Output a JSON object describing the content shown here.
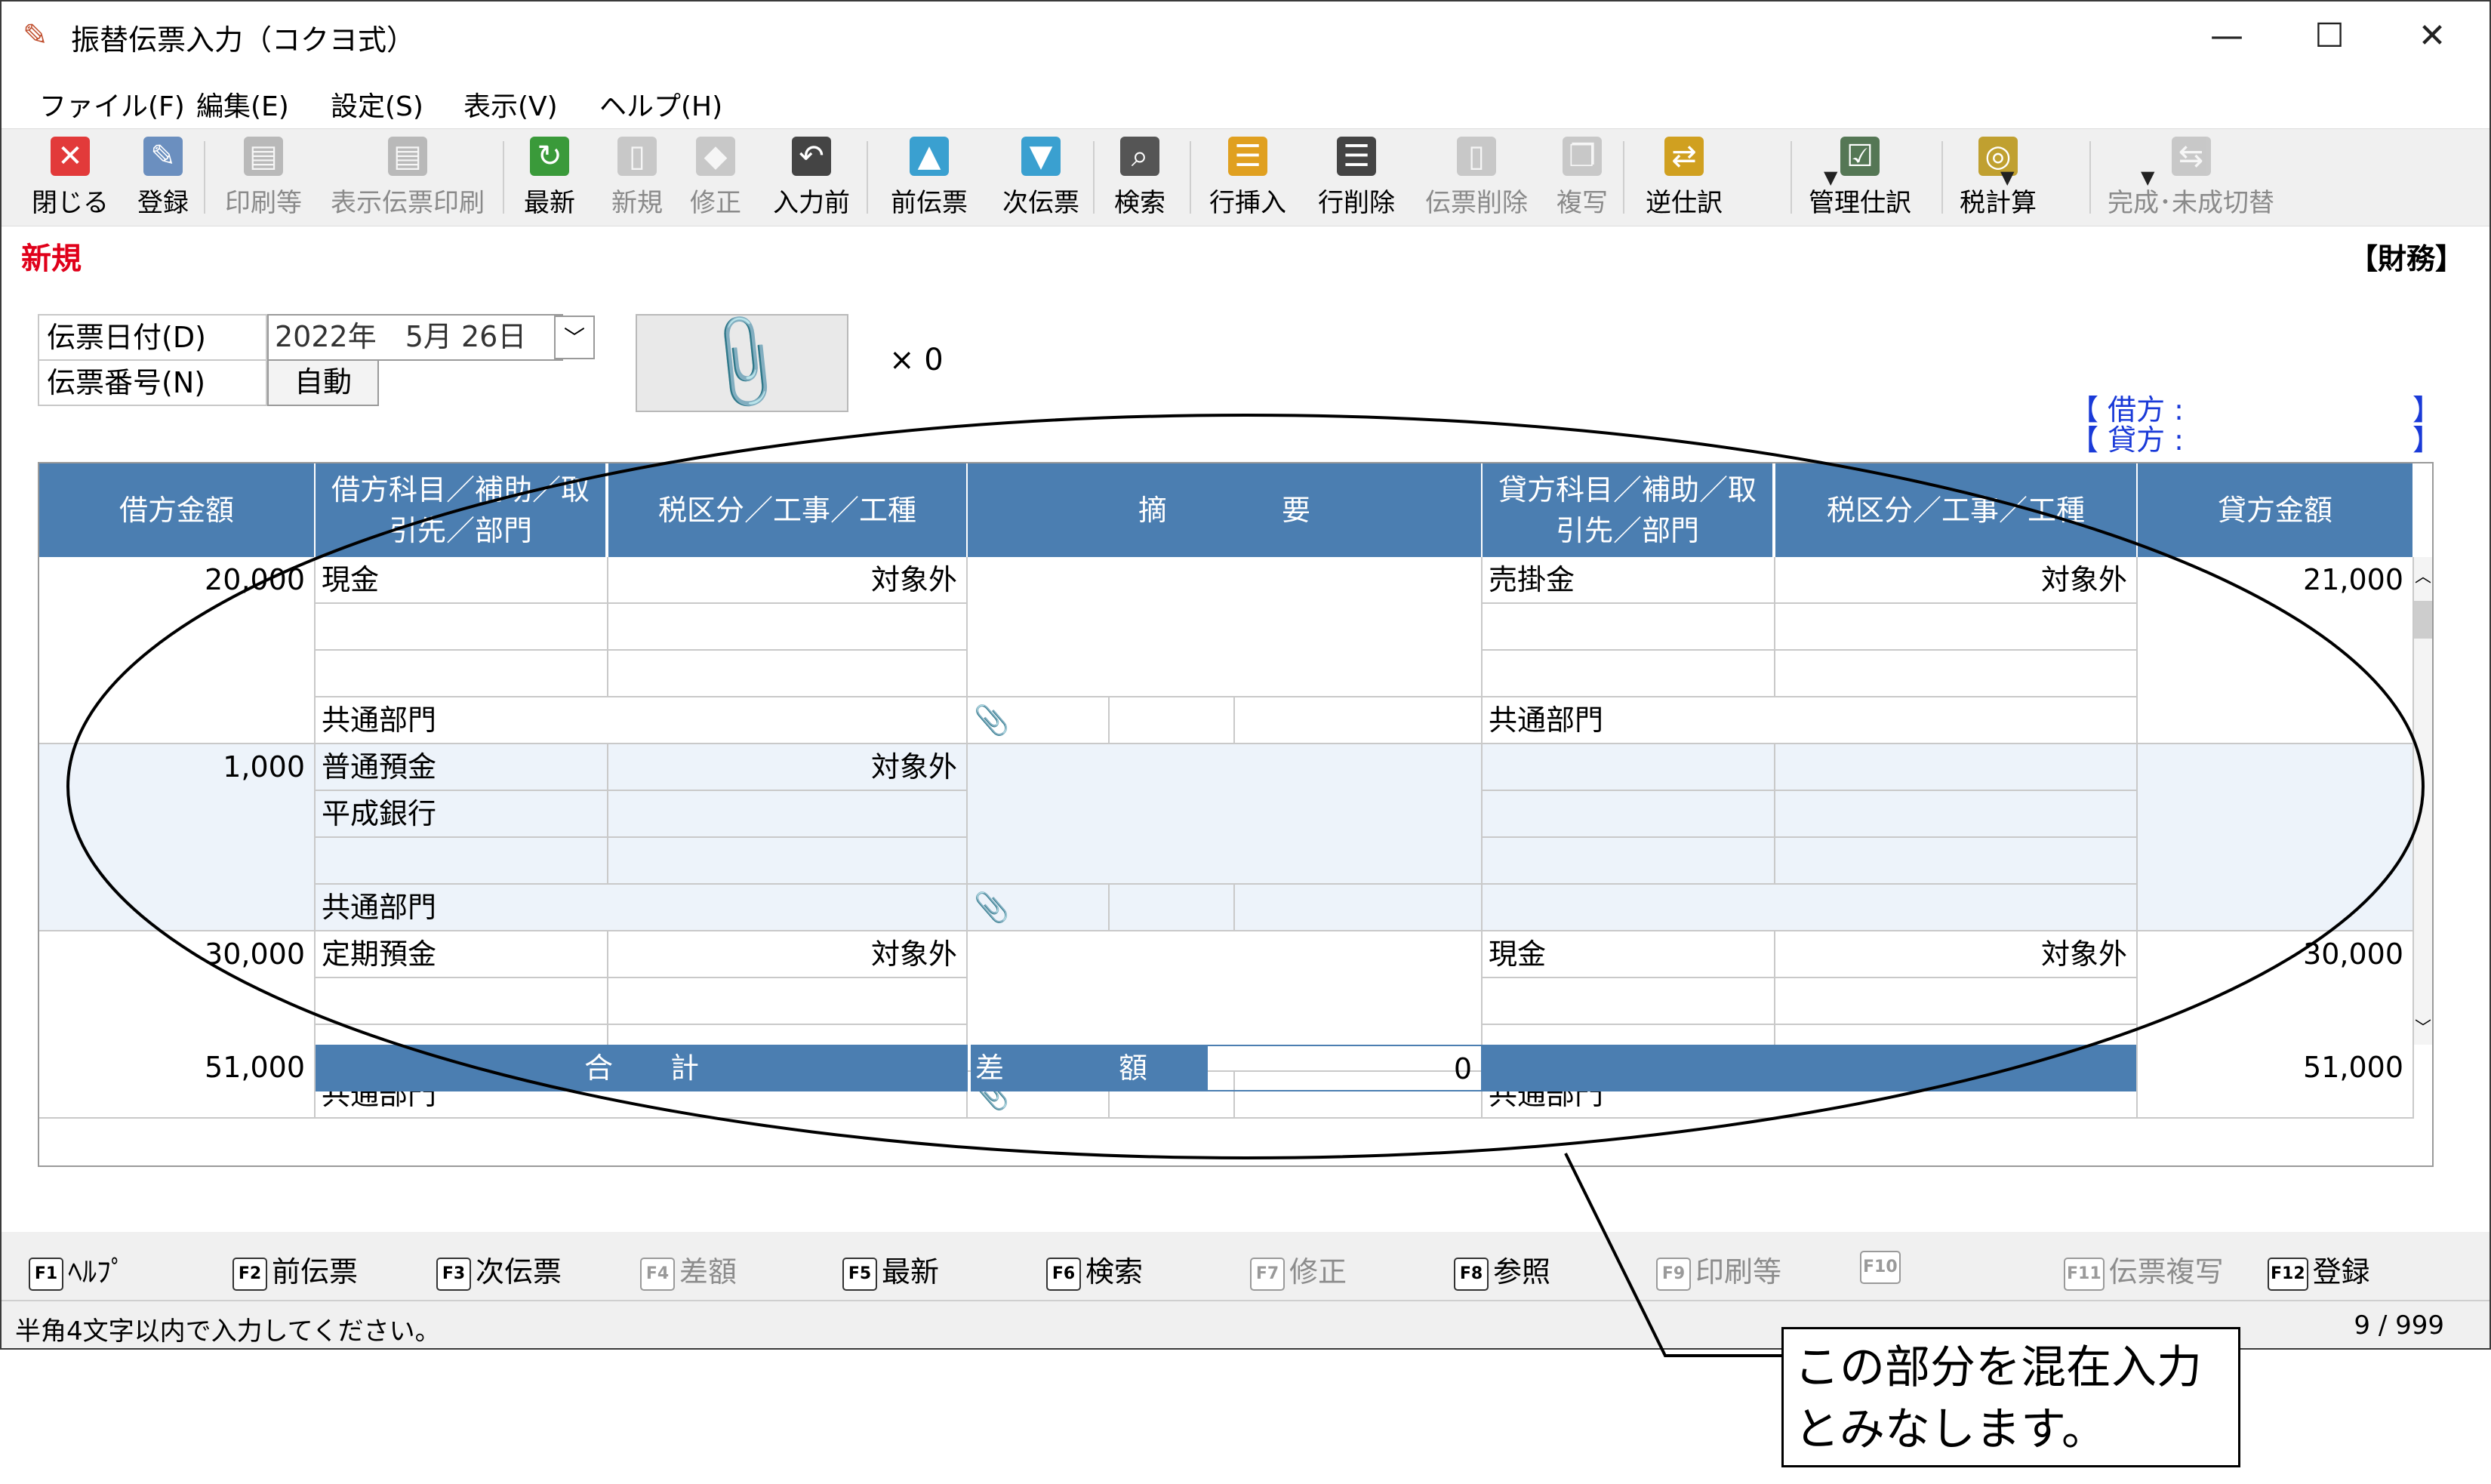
{
  "window": {
    "title": "振替伝票入力（コクヨ式）",
    "minimize": "—",
    "maximize": "☐",
    "close": "✕"
  },
  "menu": [
    "ファイル(F)",
    "編集(E)",
    "設定(S)",
    "表示(V)",
    "ヘルプ(H)"
  ],
  "toolbar": [
    {
      "label": "閉じる",
      "icon": "close-icon",
      "color": "#e23a3a",
      "enabled": true
    },
    {
      "label": "登録",
      "icon": "register-icon",
      "color": "#6b8fbf",
      "enabled": true
    },
    {
      "label": "印刷等",
      "icon": "printer-icon",
      "color": "#777777",
      "enabled": false
    },
    {
      "label": "表示伝票印刷",
      "icon": "printer-icon",
      "color": "#777777",
      "enabled": false
    },
    {
      "label": "最新",
      "icon": "refresh-icon",
      "color": "#3a9a3a",
      "enabled": true
    },
    {
      "label": "新規",
      "icon": "new-doc-icon",
      "color": "#999999",
      "enabled": false
    },
    {
      "label": "修正",
      "icon": "eraser-icon",
      "color": "#999999",
      "enabled": false
    },
    {
      "label": "入力前",
      "icon": "undo-doc-icon",
      "color": "#444444",
      "enabled": true
    },
    {
      "label": "前伝票",
      "icon": "arrow-up-icon",
      "color": "#3aa0d0",
      "enabled": true
    },
    {
      "label": "次伝票",
      "icon": "arrow-down-icon",
      "color": "#3aa0d0",
      "enabled": true
    },
    {
      "label": "検索",
      "icon": "magnifier-icon",
      "color": "#555555",
      "enabled": true
    },
    {
      "label": "行挿入",
      "icon": "row-insert-icon",
      "color": "#e0a020",
      "enabled": true
    },
    {
      "label": "行削除",
      "icon": "row-delete-icon",
      "color": "#444444",
      "enabled": true
    },
    {
      "label": "伝票削除",
      "icon": "slip-delete-icon",
      "color": "#999999",
      "enabled": false
    },
    {
      "label": "複写",
      "icon": "copy-icon",
      "color": "#999999",
      "enabled": false
    },
    {
      "label": "逆仕訳",
      "icon": "reverse-entry-icon",
      "color": "#d0a020",
      "enabled": true
    },
    {
      "label": "管理仕訳",
      "icon": "checklist-icon",
      "color": "#557755",
      "enabled": true
    },
    {
      "label": "税計算",
      "icon": "tax-calc-icon",
      "color": "#c0a030",
      "enabled": true
    },
    {
      "label": "完成･未成切替",
      "icon": "switch-icon",
      "color": "#999999",
      "enabled": false
    }
  ],
  "mode": "新規",
  "book": "【財務】",
  "form": {
    "date_label": "伝票日付(D)",
    "date_value": "2022年　5月 26日",
    "number_label": "伝票番号(N)",
    "number_value": "自動",
    "attach_count": "× 0",
    "debit_label": "【 借方 :",
    "credit_label": "【 貸方 :",
    "bracket_close": "】"
  },
  "grid": {
    "headers": {
      "debit_amount": "借方金額",
      "debit_account": "借方科目／補助／取引先／部門",
      "debit_tax": "税区分／工事／工種",
      "memo": "摘　　　　要",
      "credit_account": "貸方科目／補助／取引先／部門",
      "credit_tax": "税区分／工事／工種",
      "credit_amount": "貸方金額"
    },
    "rows": [
      {
        "debit_amount": "20,000",
        "debit_lines": [
          "現金",
          "",
          ""
        ],
        "debit_dept": "共通部門",
        "debit_tax": "対象外",
        "credit_lines": [
          "売掛金",
          "",
          ""
        ],
        "credit_dept": "共通部門",
        "credit_tax": "対象外",
        "credit_amount": "21,000"
      },
      {
        "debit_amount": "1,000",
        "debit_lines": [
          "普通預金",
          "平成銀行",
          ""
        ],
        "debit_dept": "共通部門",
        "debit_tax": "対象外",
        "credit_lines": [
          "",
          "",
          ""
        ],
        "credit_dept": "",
        "credit_tax": "",
        "credit_amount": ""
      },
      {
        "debit_amount": "30,000",
        "debit_lines": [
          "定期預金",
          "",
          ""
        ],
        "debit_dept": "共通部門",
        "debit_tax": "対象外",
        "credit_lines": [
          "現金",
          "",
          ""
        ],
        "credit_dept": "共通部門",
        "credit_tax": "対象外",
        "credit_amount": "30,000"
      }
    ],
    "totals": {
      "debit": "51,000",
      "label": "合　　計",
      "diff_label": "差　　　　額",
      "diff_value": "0",
      "credit": "51,000"
    }
  },
  "fkeys": [
    {
      "key": "F1",
      "label": "ﾍﾙﾌﾟ",
      "enabled": true
    },
    {
      "key": "F2",
      "label": "前伝票",
      "enabled": true
    },
    {
      "key": "F3",
      "label": "次伝票",
      "enabled": true
    },
    {
      "key": "F4",
      "label": "差額",
      "enabled": false
    },
    {
      "key": "F5",
      "label": "最新",
      "enabled": true
    },
    {
      "key": "F6",
      "label": "検索",
      "enabled": true
    },
    {
      "key": "F7",
      "label": "修正",
      "enabled": false
    },
    {
      "key": "F8",
      "label": "参照",
      "enabled": true
    },
    {
      "key": "F9",
      "label": "印刷等",
      "enabled": false
    },
    {
      "key": "F10",
      "label": "",
      "enabled": false
    },
    {
      "key": "F11",
      "label": "伝票複写",
      "enabled": false
    },
    {
      "key": "F12",
      "label": "登録",
      "enabled": true
    }
  ],
  "status": {
    "message": "半角4文字以内で入力してください。",
    "counter": "9 / 999"
  },
  "callout": {
    "line1": "この部分を混在入力",
    "line2": "とみなします。"
  }
}
